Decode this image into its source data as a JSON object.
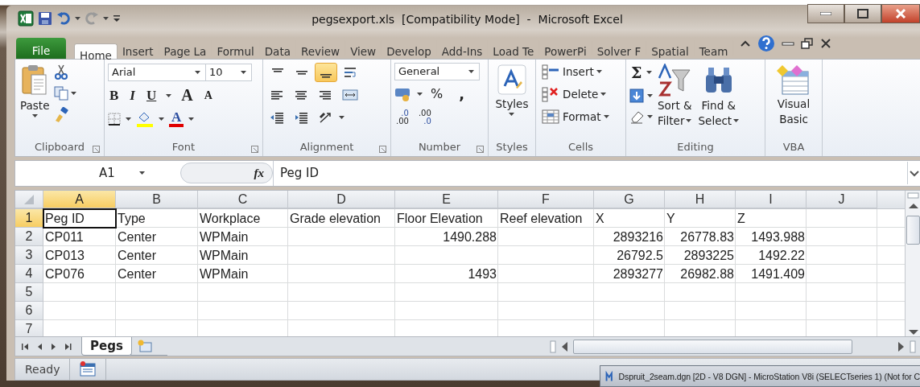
{
  "window": {
    "title": "pegsexport.xls  [Compatibility Mode]  -  Microsoft Excel"
  },
  "ribbon_tabs": [
    {
      "label": "File",
      "kind": "file",
      "selected": false
    },
    {
      "label": "Home",
      "kind": "tab",
      "selected": true
    },
    {
      "label": "Insert",
      "kind": "tab",
      "selected": false
    },
    {
      "label": "Page La",
      "kind": "tab",
      "selected": false
    },
    {
      "label": "Formul",
      "kind": "tab",
      "selected": false
    },
    {
      "label": "Data",
      "kind": "tab",
      "selected": false
    },
    {
      "label": "Review",
      "kind": "tab",
      "selected": false
    },
    {
      "label": "View",
      "kind": "tab",
      "selected": false
    },
    {
      "label": "Develop",
      "kind": "tab",
      "selected": false
    },
    {
      "label": "Add-Ins",
      "kind": "tab",
      "selected": false
    },
    {
      "label": "Load Te",
      "kind": "tab",
      "selected": false
    },
    {
      "label": "PowerPi",
      "kind": "tab",
      "selected": false
    },
    {
      "label": "Solver F",
      "kind": "tab",
      "selected": false
    },
    {
      "label": "Spatial",
      "kind": "tab",
      "selected": false
    },
    {
      "label": "Team",
      "kind": "tab",
      "selected": false
    }
  ],
  "ribbon": {
    "clipboard": {
      "label": "Clipboard",
      "paste": "Paste"
    },
    "font": {
      "label": "Font",
      "name": "Arial",
      "size": "10",
      "bold": "B",
      "italic": "I",
      "underline": "U",
      "grow": "A",
      "shrink": "A",
      "font_color": "A"
    },
    "alignment": {
      "label": "Alignment",
      "buttons": [
        {
          "kind": "top",
          "selected": false
        },
        {
          "kind": "middle",
          "selected": false
        },
        {
          "kind": "bottom",
          "selected": true
        },
        {
          "kind": "wrap",
          "selected": false
        },
        {
          "kind": "left",
          "selected": false
        },
        {
          "kind": "center",
          "selected": false
        },
        {
          "kind": "right",
          "selected": false
        },
        {
          "kind": "merge",
          "selected": false
        },
        {
          "kind": "outdent",
          "selected": false
        },
        {
          "kind": "indent",
          "selected": false
        },
        {
          "kind": "orient",
          "selected": false
        }
      ]
    },
    "number": {
      "label": "Number",
      "format": "General",
      "percent": "%",
      "comma": ",",
      "increase_decimal": {
        "top": ".0",
        "bottom": ".00"
      },
      "decrease_decimal": {
        "top": ".00",
        "bottom": ".0"
      }
    },
    "styles": {
      "label": "Styles",
      "button": "Styles"
    },
    "cells": {
      "label": "Cells",
      "buttons": [
        "Insert",
        "Delete",
        "Format"
      ]
    },
    "editing": {
      "label": "Editing",
      "autosum": "Σ",
      "sort": [
        "Sort &",
        "Filter"
      ],
      "find": [
        "Find &",
        "Select"
      ]
    },
    "vba": {
      "label": "VBA",
      "button": [
        "Visual",
        "Basic"
      ]
    }
  },
  "formula_bar": {
    "name_box": "A1",
    "function_label": "fx",
    "formula": "Peg ID"
  },
  "sheet": {
    "columns": [
      {
        "label": "A",
        "selected": true
      },
      {
        "label": "B",
        "selected": false
      },
      {
        "label": "C",
        "selected": false
      },
      {
        "label": "D",
        "selected": false
      },
      {
        "label": "E",
        "selected": false
      },
      {
        "label": "F",
        "selected": false
      },
      {
        "label": "G",
        "selected": false
      },
      {
        "label": "H",
        "selected": false
      },
      {
        "label": "I",
        "selected": false
      },
      {
        "label": "J",
        "selected": false
      }
    ],
    "rows": [
      {
        "number": "1",
        "selected": true,
        "cells": [
          {
            "value": "Peg ID",
            "kind": "text",
            "active": true
          },
          {
            "value": "Type",
            "kind": "text",
            "active": false
          },
          {
            "value": "Workplace",
            "kind": "text",
            "active": false
          },
          {
            "value": "Grade elevation",
            "kind": "text",
            "active": false
          },
          {
            "value": "Floor Elevation",
            "kind": "text",
            "active": false
          },
          {
            "value": "Reef elevation",
            "kind": "text",
            "active": false
          },
          {
            "value": "X",
            "kind": "text",
            "active": false
          },
          {
            "value": "Y",
            "kind": "text",
            "active": false
          },
          {
            "value": "Z",
            "kind": "text",
            "active": false
          }
        ]
      },
      {
        "number": "2",
        "selected": false,
        "cells": [
          {
            "value": "CP011",
            "kind": "text",
            "active": false
          },
          {
            "value": "Center",
            "kind": "text",
            "active": false
          },
          {
            "value": "WPMain",
            "kind": "text",
            "active": false
          },
          {},
          {
            "value": "1490.288",
            "kind": "number",
            "active": false
          },
          {},
          {
            "value": "2893216",
            "kind": "number",
            "active": false
          },
          {
            "value": "26778.83",
            "kind": "number",
            "active": false
          },
          {
            "value": "1493.988",
            "kind": "number",
            "active": false
          }
        ]
      },
      {
        "number": "3",
        "selected": false,
        "cells": [
          {
            "value": "CP013",
            "kind": "text",
            "active": false
          },
          {
            "value": "Center",
            "kind": "text",
            "active": false
          },
          {
            "value": "WPMain",
            "kind": "text",
            "active": false
          },
          {},
          {},
          {},
          {
            "value": "26792.5",
            "kind": "number",
            "active": false
          },
          {
            "value": "2893225",
            "kind": "number",
            "active": false
          },
          {
            "value": "1492.22",
            "kind": "number",
            "active": false
          }
        ]
      },
      {
        "number": "4",
        "selected": false,
        "cells": [
          {
            "value": "CP076",
            "kind": "text",
            "active": false
          },
          {
            "value": "Center",
            "kind": "text",
            "active": false
          },
          {
            "value": "WPMain",
            "kind": "text",
            "active": false
          },
          {},
          {
            "value": "1493",
            "kind": "number",
            "active": false
          },
          {},
          {
            "value": "2893277",
            "kind": "number",
            "active": false
          },
          {
            "value": "26982.88",
            "kind": "number",
            "active": false
          },
          {
            "value": "1491.409",
            "kind": "number",
            "active": false
          }
        ]
      },
      {
        "number": "5",
        "selected": false,
        "cells": []
      },
      {
        "number": "6",
        "selected": false,
        "cells": []
      },
      {
        "number": "7",
        "selected": false,
        "cells": []
      }
    ]
  },
  "sheet_tabs": [
    {
      "label": "Pegs",
      "selected": true
    }
  ],
  "status_bar": {
    "status": "Ready"
  },
  "taskbar_window": {
    "title": "Dspruit_2seam.dgn [2D - V8 DGN] - MicroStation V8i (SELECTseries 1) (Not for C"
  }
}
